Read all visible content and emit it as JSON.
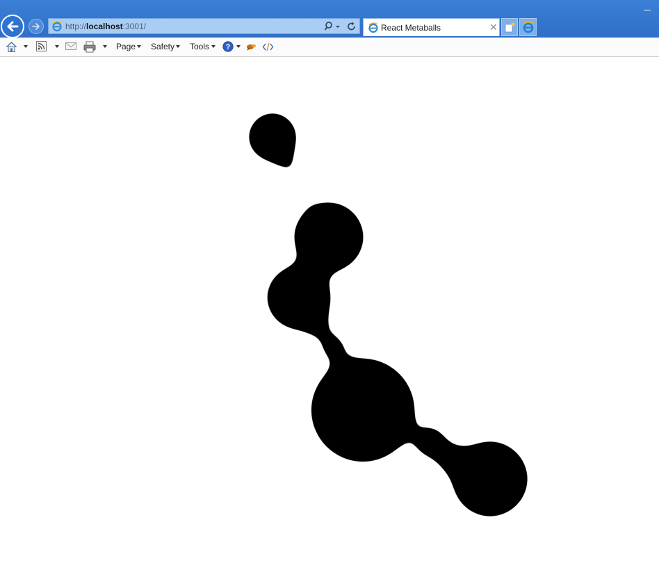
{
  "browser": {
    "address": {
      "scheme": "http://",
      "host": "localhost",
      "rest": ":3001/"
    },
    "tab": {
      "title": "React Metaballs"
    },
    "command_bar": {
      "page_label": "Page",
      "safety_label": "Safety",
      "tools_label": "Tools"
    }
  },
  "colors": {
    "chrome_blue": "#2f6fc8",
    "address_bg": "#a9cdf3",
    "metaball": "#000000"
  }
}
